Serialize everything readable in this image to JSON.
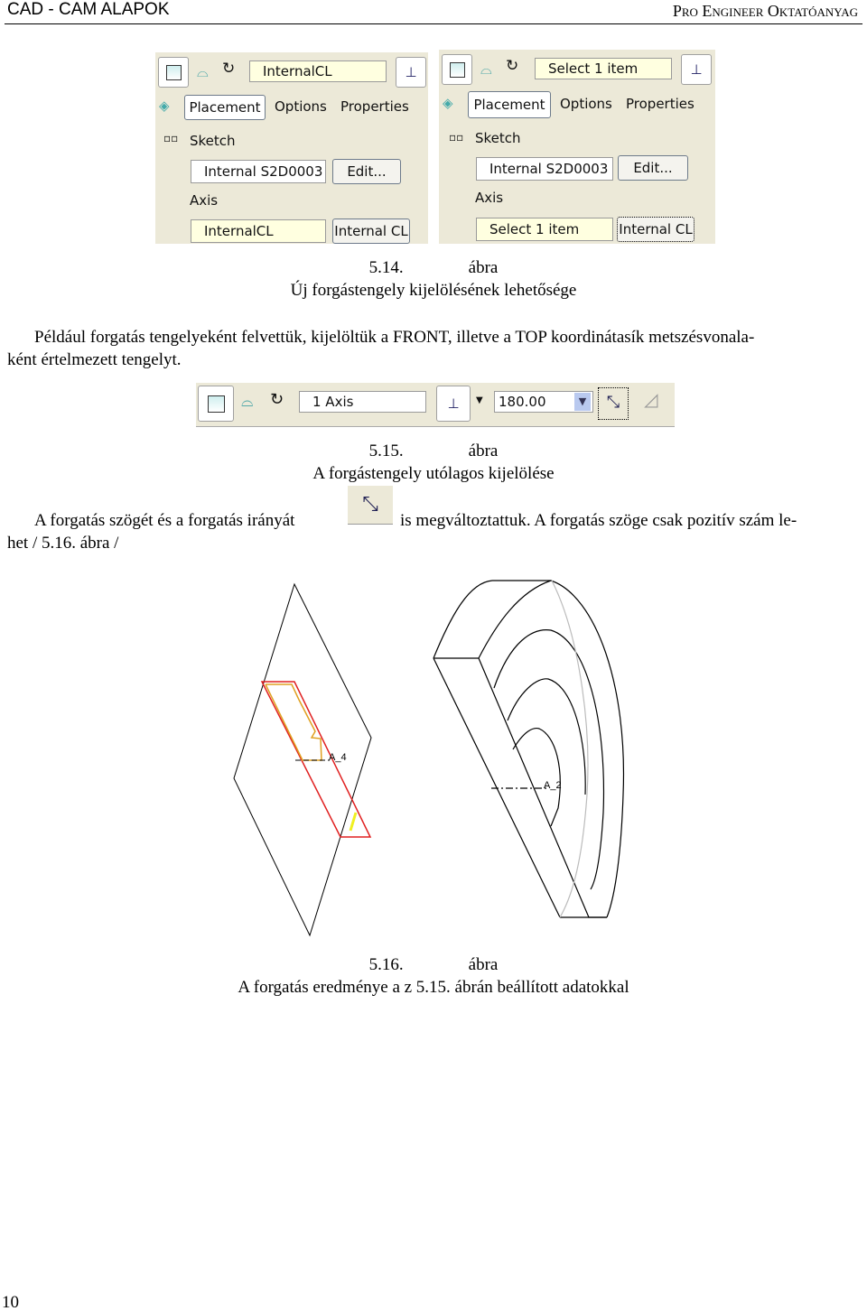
{
  "header": {
    "left": "CAD - CAM ALAPOK",
    "right": "Pro Engineer Oktatóanyag"
  },
  "fig514": {
    "left": {
      "top_field": "InternalCL",
      "tabs": [
        "Placement",
        "Options",
        "Properties"
      ],
      "sketch_label": "Sketch",
      "sketch_field": "Internal S2D0003",
      "edit_button": "Edit...",
      "axis_label": "Axis",
      "axis_field": "InternalCL",
      "axis_button": "Internal CL"
    },
    "right": {
      "top_field": "Select 1 item",
      "tabs": [
        "Placement",
        "Options",
        "Properties"
      ],
      "sketch_label": "Sketch",
      "sketch_field": "Internal S2D0003",
      "edit_button": "Edit...",
      "axis_label": "Axis",
      "axis_field": "Select 1 item",
      "axis_button": "Internal CL"
    },
    "number": "5.14.",
    "word": "ábra",
    "caption": "Új forgástengely kijelölésének lehetősége"
  },
  "para1": {
    "line1": "Például forgatás tengelyeként felvettük, kijelöltük a FRONT, illetve a TOP koordinátasík metszésvonala-",
    "line2": "ként értelmezett tengelyt."
  },
  "fig515": {
    "axis_field": "1 Axis",
    "angle_value": "180.00",
    "number": "5.15.",
    "word": "ábra",
    "caption": "A forgástengely utólagos kijelölése"
  },
  "para2": {
    "before": "A forgatás szögét és a forgatás irányát",
    "after": "is megváltoztattuk. A forgatás szöge csak pozitív szám le-",
    "line2": "het / 5.16. ábra /"
  },
  "fig516": {
    "left_label": "A_4",
    "right_label": "A_2",
    "number": "5.16.",
    "word": "ábra",
    "caption": "A forgatás eredménye a z 5.15. ábrán beállított adatokkal"
  },
  "colors": {
    "panel": "#ece9d8",
    "field": "#ffffe0",
    "sketch_red": "#e02020",
    "sketch_orange": "#e0a020",
    "highlight_yellow": "#f0f020"
  },
  "footer": {
    "page_number": "10"
  }
}
